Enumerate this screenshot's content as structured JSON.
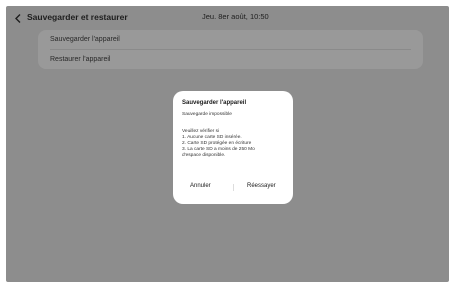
{
  "header": {
    "title": "Sauvegarder et restaurer",
    "clock": "Jeu. 8er août, 10:50"
  },
  "menu": {
    "items": [
      {
        "label": "Sauvegarder l'appareil"
      },
      {
        "label": "Restaurer l'appareil"
      }
    ]
  },
  "dialog": {
    "title": "Sauvegarder l'appareil",
    "subtitle": "Sauvegarde impossible",
    "body_lines": [
      "Veuillez vérifier si",
      "1. Aucune carte SD insérée.",
      "2. Carte SD protégée en écriture",
      "3. La carte SD a moins de 250 Mo",
      "d'espace disponible."
    ],
    "cancel_label": "Annuler",
    "retry_label": "Réessayer"
  },
  "icons": {
    "back": "chevron-left-icon"
  },
  "colors": {
    "dim_overlay": "#8d8d8d",
    "list_background": "#999999",
    "dialog_background": "#ffffff",
    "text": "#1e1e1e"
  }
}
